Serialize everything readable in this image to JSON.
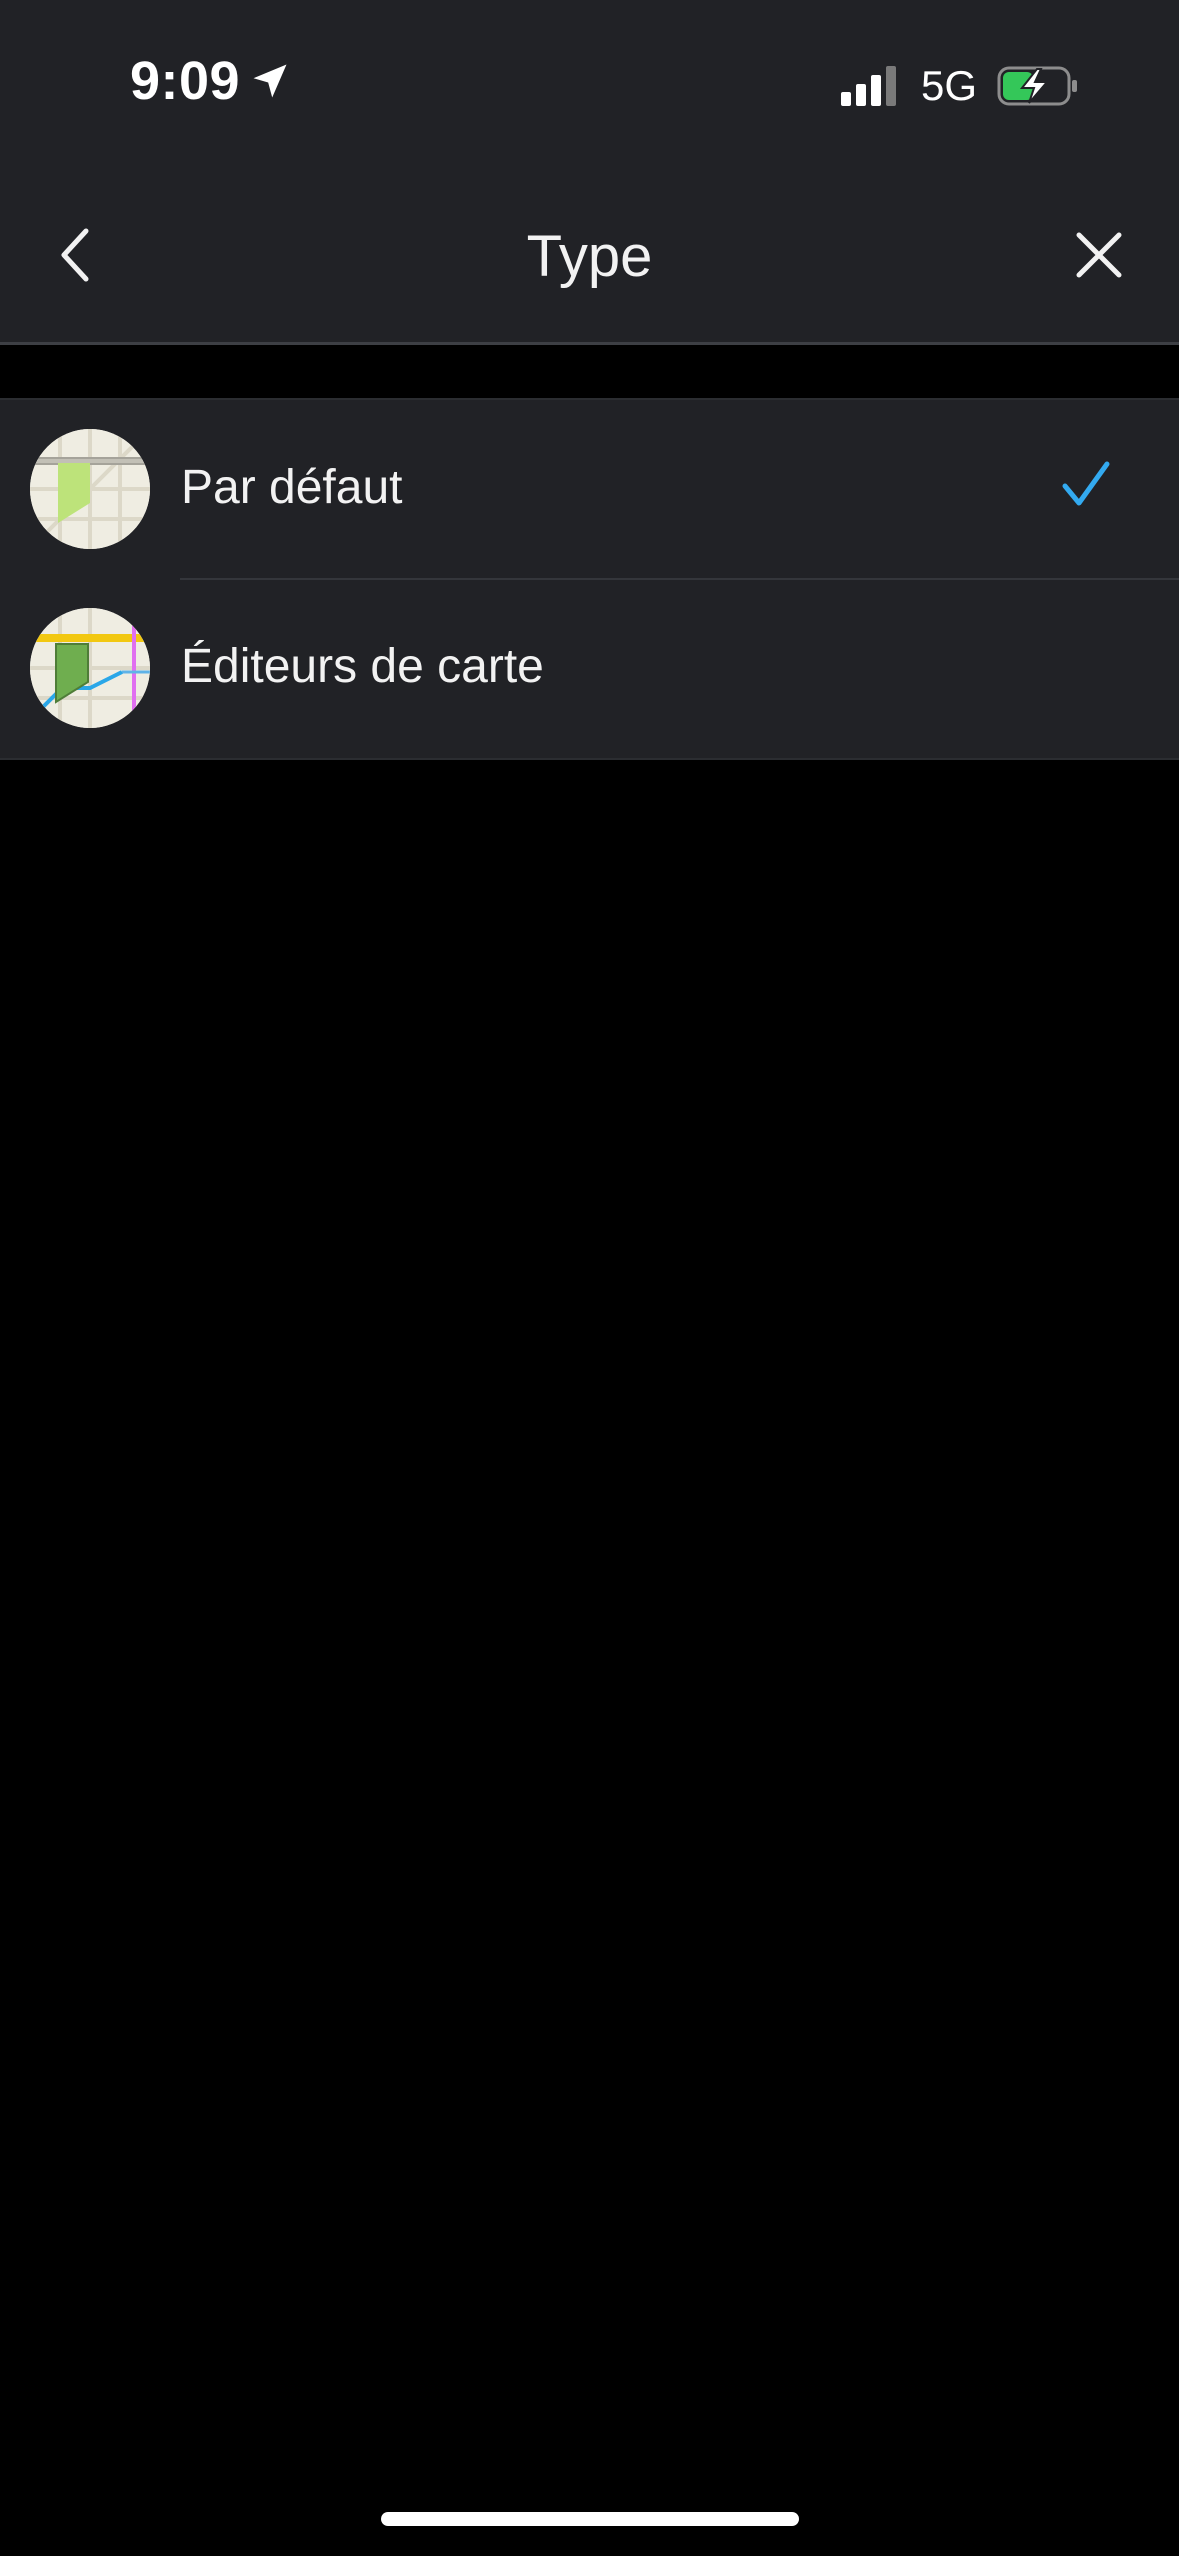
{
  "status_bar": {
    "time": "9:09",
    "network": "5G",
    "icons": [
      "location-arrow-icon",
      "signal-bars-icon",
      "battery-charging-icon"
    ]
  },
  "nav": {
    "title": "Type",
    "back_icon": "chevron-left-icon",
    "close_icon": "close-icon"
  },
  "list": {
    "items": [
      {
        "label": "Par défaut",
        "selected": true,
        "icon": "map-default-thumbnail-icon"
      },
      {
        "label": "Éditeurs de carte",
        "selected": false,
        "icon": "map-editors-thumbnail-icon"
      }
    ]
  },
  "colors": {
    "background": "#000000",
    "surface": "#212226",
    "accent_check": "#33aaf0",
    "text": "#f2f2f2"
  }
}
